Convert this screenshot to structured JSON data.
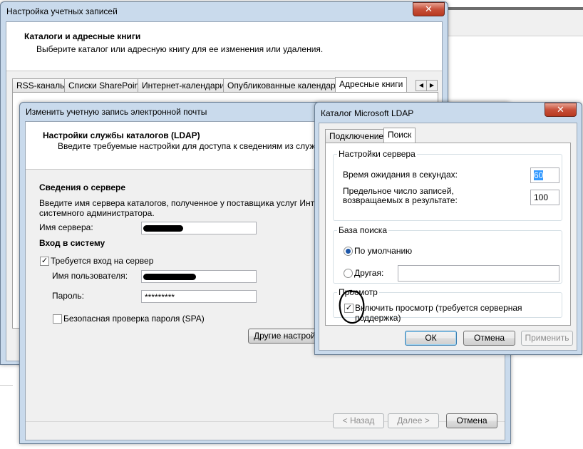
{
  "accounts_window": {
    "title": "Настройка учетных записей",
    "header_title": "Каталоги и адресные книги",
    "header_subtitle": "Выберите каталог или адресную книгу для ее изменения или удаления.",
    "tabs": [
      "RSS-каналы",
      "Списки SharePoint",
      "Интернет-календари",
      "Опубликованные календари",
      "Адресные книги"
    ],
    "active_tab": "Адресные книги",
    "close_glyph": "✕"
  },
  "email_window": {
    "title": "Изменить учетную запись электронной почты",
    "header_title": "Настройки службы каталогов (LDAP)",
    "header_subtitle": "Введите требуемые настройки для доступа к сведениям из службы ка",
    "server_section_title": "Сведения о сервере",
    "server_section_text_1": "Введите имя сервера каталогов, полученное у поставщика услуг Интернет",
    "server_section_text_2": "системного администратора.",
    "server_name_label": "Имя сервера:",
    "login_section_title": "Вход в систему",
    "login_required_label": "Требуется вход на сервер",
    "login_required_checked": true,
    "username_label": "Имя пользователя:",
    "password_label": "Пароль:",
    "password_value": "*********",
    "spa_label": "Безопасная проверка пароля (SPA)",
    "spa_checked": false,
    "more_settings_button": "Другие настрой",
    "back_button": "< Назад",
    "next_button": "Далее >",
    "cancel_button": "Отмена"
  },
  "ldap_window": {
    "title": "Каталог Microsoft LDAP",
    "close_glyph": "✕",
    "tabs": [
      "Подключение",
      "Поиск"
    ],
    "active_tab": "Поиск",
    "server_group_label": "Настройки сервера",
    "timeout_label": "Время ожидания в секундах:",
    "timeout_value": "60",
    "max_entries_label_1": "Предельное число записей,",
    "max_entries_label_2": "возвращаемых в результате:",
    "max_entries_value": "100",
    "search_base_group_label": "База поиска",
    "default_radio_label": "По умолчанию",
    "other_radio_label": "Другая:",
    "other_value": "",
    "selected_search_base": "По умолчанию",
    "browse_group_label": "Просмотр",
    "browse_checkbox_label": "Включить просмотр (требуется серверная поддержка)",
    "browse_checked": true,
    "ok_button": "ОК",
    "cancel_button": "Отмена",
    "apply_button": "Применить",
    "annotation_color": "#000000"
  },
  "icons": {
    "check": "✓",
    "tab_left": "◀",
    "tab_right": "▶"
  }
}
